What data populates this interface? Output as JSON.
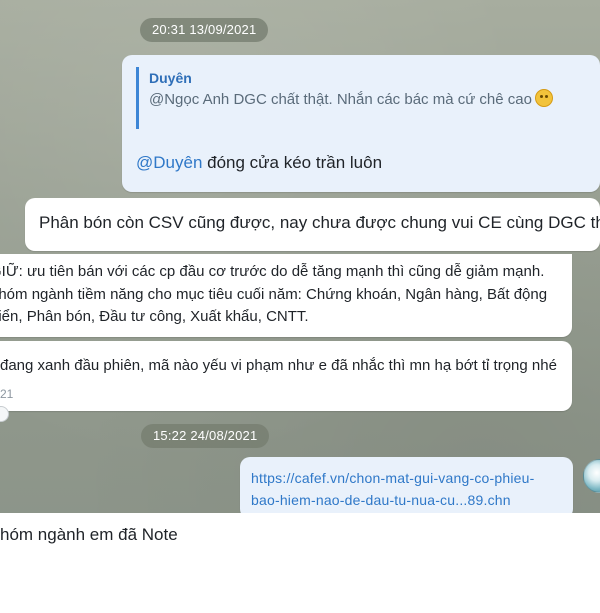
{
  "dates": {
    "top": "20:31 13/09/2021",
    "middle": "15:22 24/08/2021"
  },
  "reply_message": {
    "quote_name": "Duyên",
    "quote_text": "@Ngọc Anh DGC chất thật. Nhắn các bác mà cứ chê cao",
    "mention": "@Duyên",
    "body": " đóng cửa kéo trần luôn"
  },
  "message_csv": {
    "text": "Phân bón còn CSV cũng được, nay chưa được chung vui CE cùng DGC th"
  },
  "message_sectors": {
    "line1": "GIỮ: ưu tiên bán với các cp đầu cơ trước do dễ tăng mạnh thì cũng dễ giảm mạnh.",
    "line2": "nhóm ngành tiềm năng cho mục tiêu cuối năm: Chứng khoán, Ngân hàng, Bất động",
    "line3": "biển, Phân bón, Đầu tư công, Xuất khẩu, CNTT."
  },
  "message_green": {
    "text": "đang xanh đầu phiên, mã nào yếu vi phạm như e đã nhắc thì mn hạ bớt tỉ trọng nhé",
    "time_fragment": "21"
  },
  "message_link": {
    "line1": "https://cafef.vn/chon-mat-gui-vang-co-phieu-",
    "line2": "bao-hiem-nao-de-dau-tu-nua-cu...89.chn"
  },
  "message_note": {
    "text": "hóm ngành em đã Note"
  },
  "icons": {
    "emoji": "grinning-sweat-emoji-icon",
    "avatar": "user-avatar-icon"
  },
  "colors": {
    "bubble_outgoing": "#e9f1fb",
    "bubble_incoming": "#ffffff",
    "accent": "#3d86d6"
  }
}
